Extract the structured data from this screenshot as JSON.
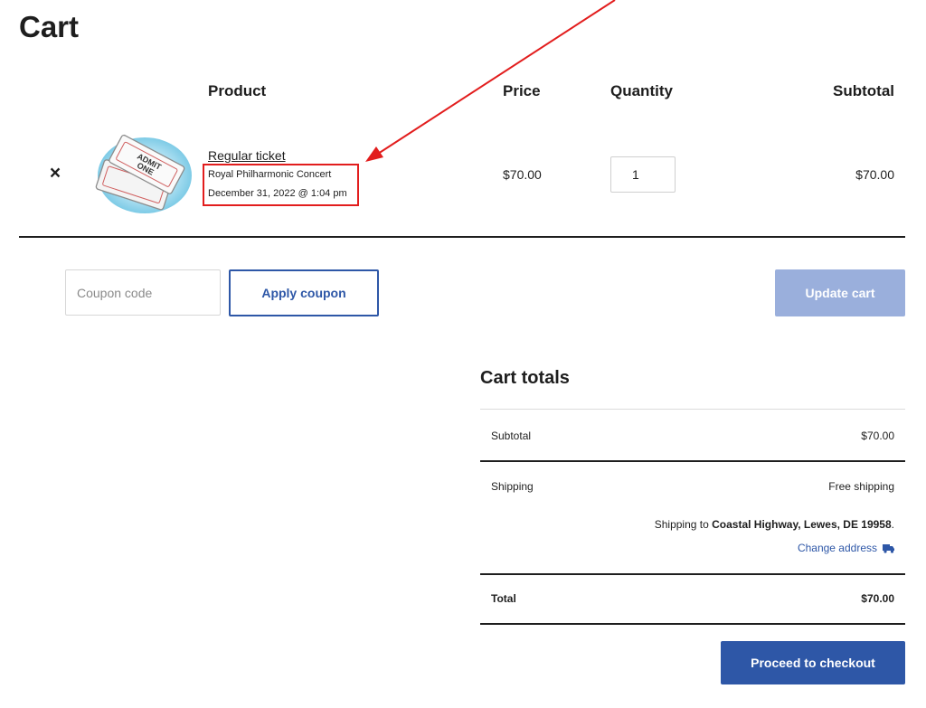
{
  "page": {
    "title": "Cart"
  },
  "table": {
    "headers": {
      "product": "Product",
      "price": "Price",
      "quantity": "Quantity",
      "subtotal": "Subtotal"
    },
    "rows": [
      {
        "remove_icon": "×",
        "image_alt": "Admit one ticket",
        "image_text_1": "ADMIT",
        "image_text_2": "ONE",
        "name": "Regular ticket",
        "event": "Royal Philharmonic Concert",
        "date": "December 31, 2022 @ 1:04 pm",
        "price": "$70.00",
        "quantity": "1",
        "subtotal": "$70.00"
      }
    ]
  },
  "coupon": {
    "placeholder": "Coupon code",
    "apply_label": "Apply coupon"
  },
  "update_label": "Update cart",
  "totals": {
    "title": "Cart totals",
    "subtotal_label": "Subtotal",
    "subtotal_value": "$70.00",
    "shipping_label": "Shipping",
    "shipping_value": "Free shipping",
    "shipping_to_prefix": "Shipping to ",
    "shipping_to_address": "Coastal Highway, Lewes, DE 19958",
    "shipping_to_suffix": ".",
    "change_address": "Change address",
    "total_label": "Total",
    "total_value": "$70.00"
  },
  "checkout_label": "Proceed to checkout",
  "icons": {
    "remove": "close-icon",
    "change_address": "truck-icon"
  },
  "colors": {
    "accent": "#2e57a7",
    "accent_disabled": "#9aafdc",
    "annotation": "#e21d1d",
    "text": "#1e1e1e"
  }
}
